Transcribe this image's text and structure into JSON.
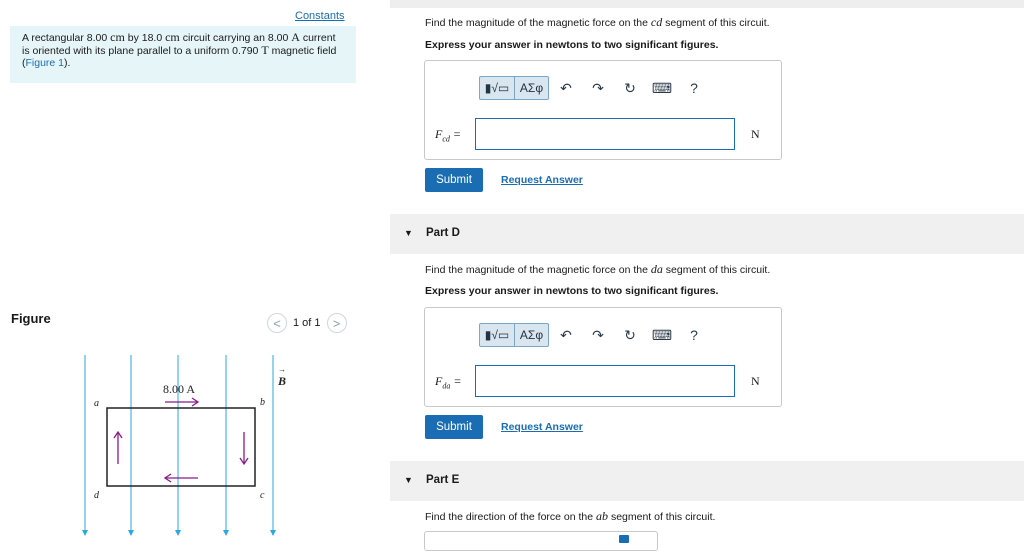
{
  "left_panel": {
    "constants_link": "Constants",
    "problem_parts": [
      "A rectangular 8.00 ",
      "cm",
      " by 18.0 ",
      "cm",
      " circuit carrying an 8.00 ",
      "A",
      " current is oriented with its plane parallel to a uniform 0.790 ",
      "T",
      " magnetic field (",
      "Figure 1",
      ")."
    ],
    "figure_title": "Figure",
    "pager_prev": "<",
    "pager_text": "1 of 1",
    "pager_next": ">",
    "figure": {
      "current_label": "8.00 A",
      "field_label": "B",
      "corner_a": "a",
      "corner_b": "b",
      "corner_c": "c",
      "corner_d": "d"
    }
  },
  "toolbar": {
    "templates": "▮√▭",
    "greek": "ΑΣφ",
    "undo": "↶",
    "redo": "↷",
    "reset": "↻",
    "keyboard": "⌨",
    "help": "?"
  },
  "part_c": {
    "prompt_before": "Find the magnitude of the magnetic force on the ",
    "prompt_var": "cd",
    "prompt_after": " segment of this circuit.",
    "instruction": "Express your answer in newtons to two significant figures.",
    "answer_label": "F",
    "answer_sub": "cd",
    "answer_eq": " =",
    "answer_value": "",
    "unit": "N",
    "submit": "Submit",
    "request": "Request Answer"
  },
  "part_d": {
    "title": "Part D",
    "prompt_before": "Find the magnitude of the magnetic force on the ",
    "prompt_var": "da",
    "prompt_after": " segment of this circuit.",
    "instruction": "Express your answer in newtons to two significant figures.",
    "answer_label": "F",
    "answer_sub": "da",
    "answer_eq": " =",
    "answer_value": "",
    "unit": "N",
    "submit": "Submit",
    "request": "Request Answer"
  },
  "part_e": {
    "title": "Part E",
    "prompt_before": "Find the direction of the force on the ",
    "prompt_var": "ab",
    "prompt_after": " segment  of this circuit."
  },
  "colors": {
    "accent": "#1a6db3",
    "problem_bg": "#e6f5f8",
    "field_lines": "#2aa8e0",
    "current_arrows": "#8b1a8b"
  }
}
